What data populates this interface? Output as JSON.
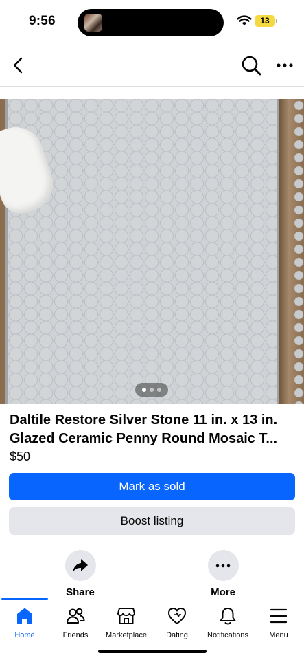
{
  "status_bar": {
    "time": "9:56",
    "battery_level": "13",
    "battery_color": "#f4d940",
    "island_indicator": "······"
  },
  "nav": {
    "back_icon": "chevron-left-icon",
    "search_icon": "search-icon",
    "more_icon": "ellipsis-icon"
  },
  "listing": {
    "image": "penny-round-mosaic-tile-photo",
    "image_count": 3,
    "active_image_index": 0,
    "title": "Daltile Restore Silver Stone 11 in. x 13 in. Glazed Ceramic Penny Round Mosaic T...",
    "price": "$50"
  },
  "buttons": {
    "mark_sold_label": "Mark as sold",
    "boost_label": "Boost listing",
    "primary_color": "#0866ff",
    "secondary_color": "#e4e6eb"
  },
  "actions": [
    {
      "label": "Share",
      "icon": "share-arrow-icon"
    },
    {
      "label": "More",
      "icon": "ellipsis-icon"
    }
  ],
  "tab_bar": {
    "active_tab": "Home",
    "tabs": [
      {
        "label": "Home",
        "icon": "home-icon"
      },
      {
        "label": "Friends",
        "icon": "friends-icon"
      },
      {
        "label": "Marketplace",
        "icon": "marketplace-icon"
      },
      {
        "label": "Dating",
        "icon": "heart-icon"
      },
      {
        "label": "Notifications",
        "icon": "bell-icon"
      },
      {
        "label": "Menu",
        "icon": "menu-icon"
      }
    ]
  }
}
